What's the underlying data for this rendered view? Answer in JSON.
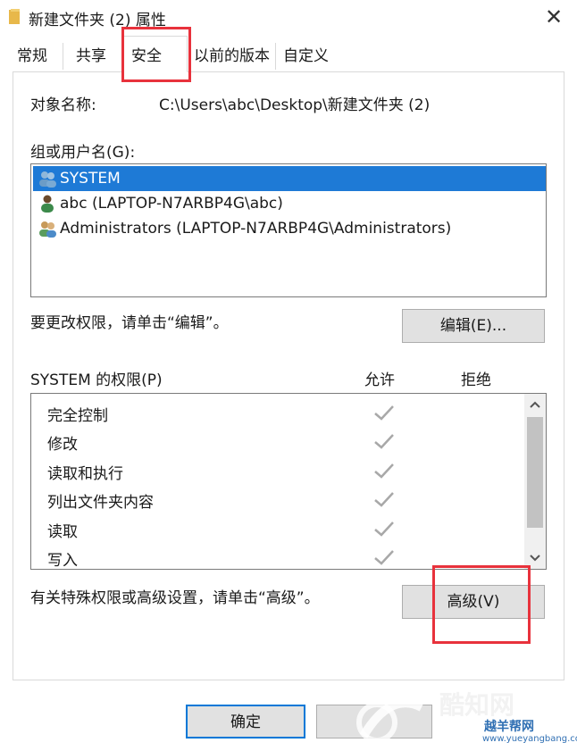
{
  "window": {
    "title": "新建文件夹 (2) 属性",
    "close_glyph": "✕"
  },
  "tabs": [
    "常规",
    "共享",
    "安全",
    "以前的版本",
    "自定义"
  ],
  "active_tab": "安全",
  "object_name": {
    "label": "对象名称:",
    "value": "C:\\Users\\abc\\Desktop\\新建文件夹 (2)"
  },
  "groups": {
    "label": "组或用户名(G):",
    "items": [
      {
        "name": "SYSTEM",
        "icon": "group-users-icon",
        "selected": true
      },
      {
        "name": "abc (LAPTOP-N7ARBP4G\\abc)",
        "icon": "user-icon",
        "selected": false
      },
      {
        "name": "Administrators (LAPTOP-N7ARBP4G\\Administrators)",
        "icon": "group-users-icon",
        "selected": false
      }
    ]
  },
  "edit": {
    "hint": "要更改权限，请单击“编辑”。",
    "button": "编辑(E)..."
  },
  "permissions": {
    "title": "SYSTEM 的权限(P)",
    "allow_header": "允许",
    "deny_header": "拒绝",
    "rows": [
      {
        "name": "完全控制",
        "allow": true,
        "deny": false
      },
      {
        "name": "修改",
        "allow": true,
        "deny": false
      },
      {
        "name": "读取和执行",
        "allow": true,
        "deny": false
      },
      {
        "name": "列出文件夹内容",
        "allow": true,
        "deny": false
      },
      {
        "name": "读取",
        "allow": true,
        "deny": false
      },
      {
        "name": "写入",
        "allow": true,
        "deny": false
      }
    ]
  },
  "advanced": {
    "hint": "有关特殊权限或高级设置，请单击“高级”。",
    "button": "高级(V)"
  },
  "footer": {
    "ok_button": "确定"
  },
  "watermark": {
    "brand": "酷知网",
    "site": "www.yueyangbang.com",
    "sub": "越羊帮网"
  },
  "colors": {
    "selection": "#1e7ad6",
    "annotation": "#e8323c",
    "check": "#a8a8a8"
  }
}
